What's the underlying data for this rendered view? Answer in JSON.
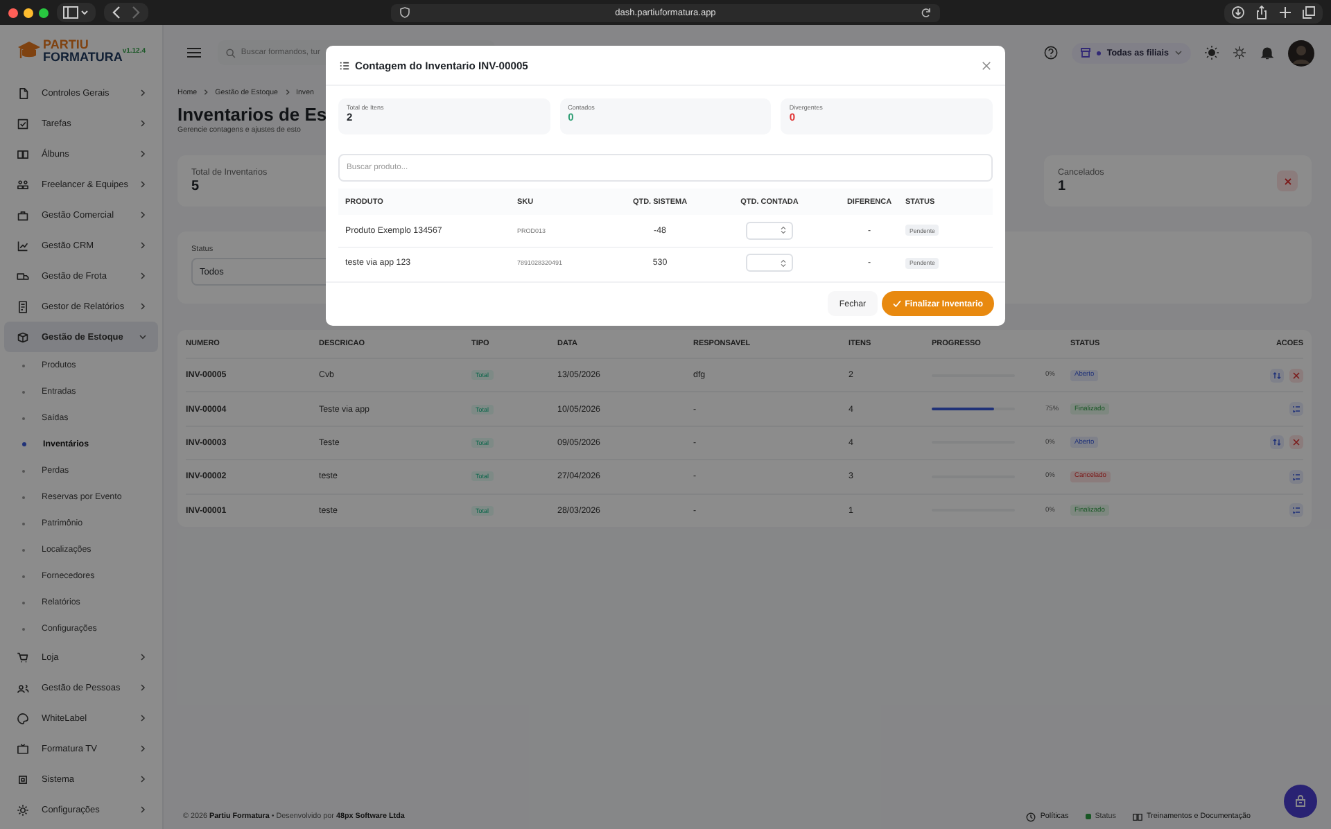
{
  "browser": {
    "url": "dash.partiuformatura.app"
  },
  "brand": {
    "logo_top": "PARTIU",
    "logo_bottom": "FORMATURA",
    "version": "v1.12.4"
  },
  "sidebar": {
    "items": [
      {
        "label": "Controles Gerais",
        "selected": false,
        "expanded": false
      },
      {
        "label": "Tarefas",
        "selected": false,
        "expanded": false
      },
      {
        "label": "Álbuns",
        "selected": false,
        "expanded": false
      },
      {
        "label": "Freelancer & Equipes",
        "selected": false,
        "expanded": false
      },
      {
        "label": "Gestão Comercial",
        "selected": false,
        "expanded": false
      },
      {
        "label": "Gestão CRM",
        "selected": false,
        "expanded": false
      },
      {
        "label": "Gestão de Frota",
        "selected": false,
        "expanded": false
      },
      {
        "label": "Gestor de Relatórios",
        "selected": false,
        "expanded": false
      },
      {
        "label": "Gestão de Estoque",
        "selected": true,
        "expanded": true,
        "children": [
          {
            "label": "Produtos",
            "selected": false
          },
          {
            "label": "Entradas",
            "selected": false
          },
          {
            "label": "Saídas",
            "selected": false
          },
          {
            "label": "Inventários",
            "selected": true
          },
          {
            "label": "Perdas",
            "selected": false
          },
          {
            "label": "Reservas por Evento",
            "selected": false
          },
          {
            "label": "Patrimônio",
            "selected": false
          },
          {
            "label": "Localizações",
            "selected": false
          },
          {
            "label": "Fornecedores",
            "selected": false
          },
          {
            "label": "Relatórios",
            "selected": false
          },
          {
            "label": "Configurações",
            "selected": false
          }
        ]
      },
      {
        "label": "Loja",
        "selected": false,
        "expanded": false
      },
      {
        "label": "Gestão de Pessoas",
        "selected": false,
        "expanded": false
      },
      {
        "label": "WhiteLabel",
        "selected": false,
        "expanded": false
      },
      {
        "label": "Formatura TV",
        "selected": false,
        "expanded": false
      },
      {
        "label": "Sistema",
        "selected": false,
        "expanded": false
      },
      {
        "label": "Configurações",
        "selected": false,
        "expanded": false
      }
    ]
  },
  "header": {
    "search": {
      "placeholder": "Buscar formandos, tur"
    },
    "branch": "Todas as filiais"
  },
  "page": {
    "breadcrumb": [
      "Home",
      "Gestão de Estoque",
      "Inven"
    ],
    "title": "Inventarios de Es",
    "subtitle": "Gerencie contagens e ajustes de esto",
    "stats": [
      {
        "label": "Total de Inventarios",
        "value": "5",
        "kind": "plain"
      },
      {
        "label": "Cancelados",
        "value": "1",
        "kind": "cancel"
      }
    ],
    "filter": {
      "label": "Status",
      "value": "Todos"
    },
    "table": {
      "columns": [
        "NUMERO",
        "DESCRICAO",
        "TIPO",
        "DATA",
        "RESPONSAVEL",
        "ITENS",
        "PROGRESSO",
        "STATUS",
        "ACOES"
      ],
      "rows": [
        {
          "numero": "INV-00005",
          "descricao": "Cvb",
          "tipo": "Total",
          "data": "13/05/2026",
          "responsavel": "dfg",
          "itens": "2",
          "level": 0,
          "progress": "0%",
          "status": "Aberto",
          "kind": "open",
          "actions": [
            {
              "kind": "count"
            },
            {
              "kind": "cancel"
            }
          ]
        },
        {
          "numero": "INV-00004",
          "descricao": "Teste via app",
          "tipo": "Total",
          "data": "10/05/2026",
          "responsavel": "-",
          "itens": "4",
          "level": 0.75,
          "progress": "75%",
          "status": "Finalizado",
          "kind": "done",
          "actions": [
            {
              "kind": "view"
            }
          ]
        },
        {
          "numero": "INV-00003",
          "descricao": "Teste",
          "tipo": "Total",
          "data": "09/05/2026",
          "responsavel": "-",
          "itens": "4",
          "level": 0,
          "progress": "0%",
          "status": "Aberto",
          "kind": "open",
          "actions": [
            {
              "kind": "count"
            },
            {
              "kind": "cancel"
            }
          ]
        },
        {
          "numero": "INV-00002",
          "descricao": "teste",
          "tipo": "Total",
          "data": "27/04/2026",
          "responsavel": "-",
          "itens": "3",
          "level": 0,
          "progress": "0%",
          "status": "Cancelado",
          "kind": "cancelled",
          "actions": [
            {
              "kind": "view"
            }
          ]
        },
        {
          "numero": "INV-00001",
          "descricao": "teste",
          "tipo": "Total",
          "data": "28/03/2026",
          "responsavel": "-",
          "itens": "1",
          "level": 0,
          "progress": "0%",
          "status": "Finalizado",
          "kind": "done",
          "actions": [
            {
              "kind": "view"
            }
          ]
        }
      ]
    }
  },
  "footer": {
    "credit": "© 2026 **Partiu Formatura** • Desenvolvido por **48px Software Ltda**",
    "links": [
      {
        "label": "Políticas",
        "kind": "policy"
      },
      {
        "label": "Status",
        "kind": "status"
      },
      {
        "label": "Treinamentos e Documentação",
        "kind": "docs"
      }
    ]
  },
  "modal": {
    "title": "Contagem do Inventario INV-00005",
    "stats": [
      {
        "label": "Total de Itens",
        "value": "2",
        "color": "#1f2328"
      },
      {
        "label": "Contados",
        "value": "0",
        "color": "#2f9e74"
      },
      {
        "label": "Divergentes",
        "value": "0",
        "color": "#e03131"
      }
    ],
    "search": {
      "placeholder": "Buscar produto..."
    },
    "columns": [
      "PRODUTO",
      "SKU",
      "QTD. SISTEMA",
      "QTD. CONTADA",
      "DIFERENCA",
      "STATUS"
    ],
    "rows": [
      {
        "produto": "Produto Exemplo 134567",
        "sku": "PROD013",
        "sistema": "-48",
        "diferenca": "-",
        "status": "Pendente"
      },
      {
        "produto": "teste via app 123",
        "sku": "7891028320491",
        "sistema": "530",
        "diferenca": "-",
        "status": "Pendente"
      }
    ],
    "buttons": [
      {
        "label": "Fechar",
        "kind": "secondary"
      },
      {
        "label": "Finalizar Inventario",
        "kind": "primary"
      }
    ]
  }
}
